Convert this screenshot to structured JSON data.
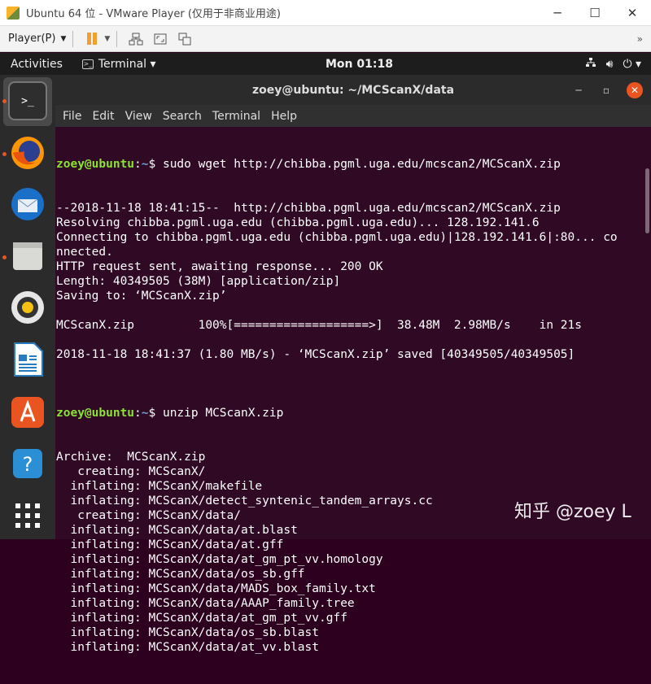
{
  "vm": {
    "title": "Ubuntu 64 位 - VMware Player (仅用于非商业用途)",
    "player_menu": "Player(P)",
    "ctrl_minimize": "─",
    "ctrl_maximize": "☐",
    "ctrl_close": "✕"
  },
  "panel": {
    "activities": "Activities",
    "app_name": "Terminal ▾",
    "clock": "Mon 01:18",
    "tray": [
      "network-icon",
      "volume-icon",
      "power-icon"
    ]
  },
  "dock": {
    "items": [
      "terminal",
      "firefox",
      "thunderbird",
      "files",
      "rhythmbox",
      "libreoffice-writer",
      "ubuntu-software",
      "help",
      "show-applications"
    ]
  },
  "terminal": {
    "title": "zoey@ubuntu: ~/MCScanX/data",
    "menu": [
      "File",
      "Edit",
      "View",
      "Search",
      "Terminal",
      "Help"
    ],
    "prompt_user": "zoey@ubuntu",
    "prompt_path": "~",
    "commands": {
      "cmd1": "sudo wget http://chibba.pgml.uga.edu/mcscan2/MCScanX.zip",
      "cmd2": "unzip MCScanX.zip"
    },
    "output1": [
      "--2018-11-18 18:41:15--  http://chibba.pgml.uga.edu/mcscan2/MCScanX.zip",
      "Resolving chibba.pgml.uga.edu (chibba.pgml.uga.edu)... 128.192.141.6",
      "Connecting to chibba.pgml.uga.edu (chibba.pgml.uga.edu)|128.192.141.6|:80... co",
      "nnected.",
      "HTTP request sent, awaiting response... 200 OK",
      "Length: 40349505 (38M) [application/zip]",
      "Saving to: ‘MCScanX.zip’",
      "",
      "MCScanX.zip         100%[===================>]  38.48M  2.98MB/s    in 21s",
      "",
      "2018-11-18 18:41:37 (1.80 MB/s) - ‘MCScanX.zip’ saved [40349505/40349505]",
      ""
    ],
    "output2": [
      "Archive:  MCScanX.zip",
      "   creating: MCScanX/",
      "  inflating: MCScanX/makefile",
      "  inflating: MCScanX/detect_syntenic_tandem_arrays.cc",
      "   creating: MCScanX/data/",
      "  inflating: MCScanX/data/at.blast",
      "  inflating: MCScanX/data/at.gff",
      "  inflating: MCScanX/data/at_gm_pt_vv.homology",
      "  inflating: MCScanX/data/os_sb.gff",
      "  inflating: MCScanX/data/MADS_box_family.txt",
      "  inflating: MCScanX/data/AAAP_family.tree",
      "  inflating: MCScanX/data/at_gm_pt_vv.gff",
      "  inflating: MCScanX/data/os_sb.blast",
      "  inflating: MCScanX/data/at_vv.blast"
    ]
  },
  "watermark": "知乎 @zoey L"
}
